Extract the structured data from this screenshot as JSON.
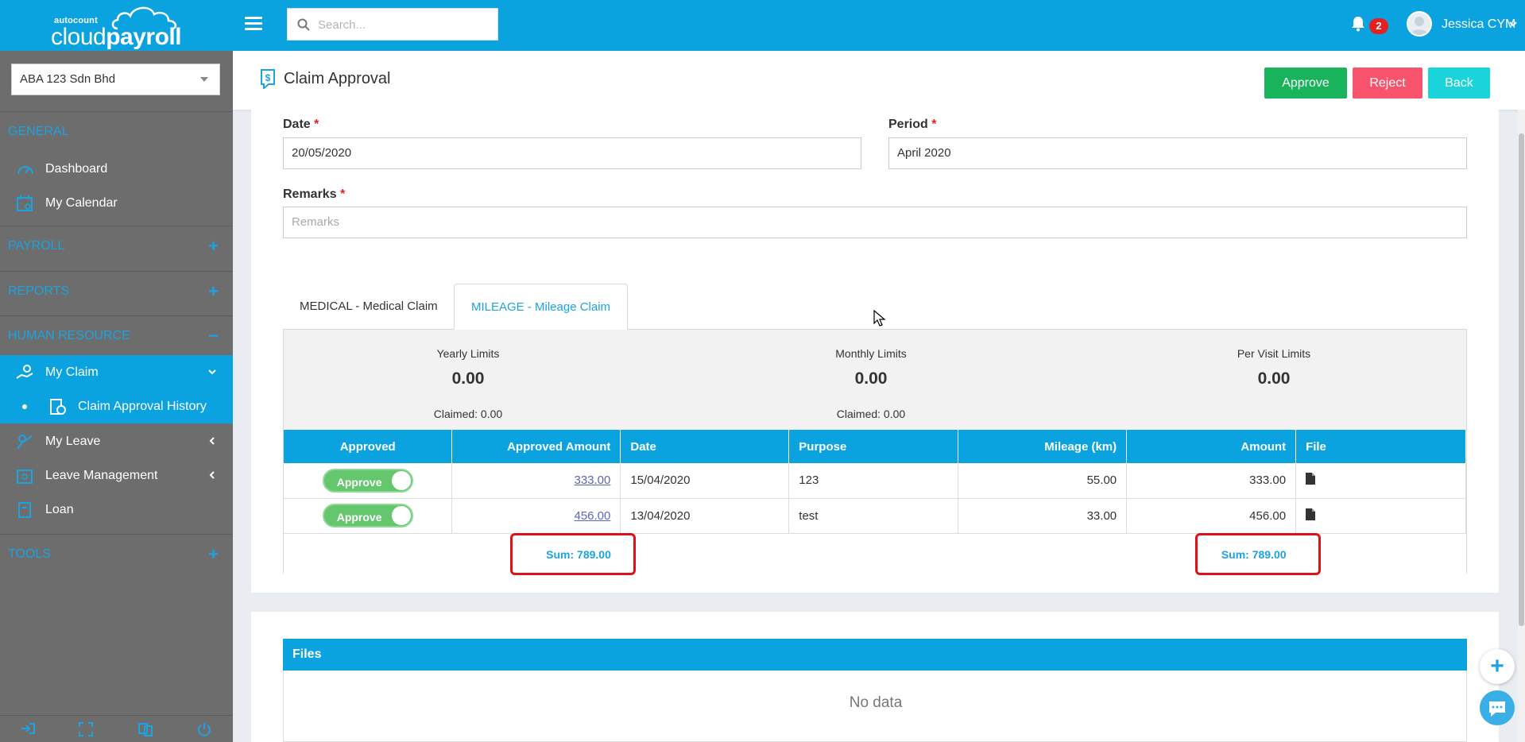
{
  "brand": {
    "small": "autocount",
    "cloud": "cloud",
    "payroll": "payroll"
  },
  "search": {
    "placeholder": "Search..."
  },
  "notifications": {
    "count": "2"
  },
  "user": {
    "name": "Jessica CYM"
  },
  "sidebar": {
    "company": "ABA 123 Sdn Bhd",
    "general": "GENERAL",
    "dashboard": "Dashboard",
    "calendar": "My Calendar",
    "payroll": "PAYROLL",
    "reports": "REPORTS",
    "hr": "HUMAN RESOURCE",
    "my_claim": "My Claim",
    "claim_history": "Claim Approval History",
    "my_leave": "My Leave",
    "leave_mgmt": "Leave Management",
    "loan": "Loan",
    "tools": "TOOLS"
  },
  "page": {
    "title": "Claim Approval",
    "approve": "Approve",
    "reject": "Reject",
    "back": "Back"
  },
  "form": {
    "date_label": "Date",
    "date_value": "20/05/2020",
    "period_label": "Period",
    "period_value": "April 2020",
    "remarks_label": "Remarks",
    "remarks_placeholder": "Remarks",
    "required": "*"
  },
  "tabs": {
    "medical": "MEDICAL - Medical Claim",
    "mileage": "MILEAGE - Mileage Claim"
  },
  "limits": {
    "yearly_label": "Yearly Limits",
    "yearly_value": "0.00",
    "yearly_claimed": "Claimed: 0.00",
    "monthly_label": "Monthly Limits",
    "monthly_value": "0.00",
    "monthly_claimed": "Claimed: 0.00",
    "pervisit_label": "Per Visit Limits",
    "pervisit_value": "0.00"
  },
  "table": {
    "headers": [
      "Approved",
      "Approved Amount",
      "Date",
      "Purpose",
      "Mileage (km)",
      "Amount",
      "File"
    ],
    "rows": [
      {
        "toggle": "Approve",
        "approved_amount": "333.00",
        "date": "15/04/2020",
        "purpose": "123",
        "mileage": "55.00",
        "amount": "333.00"
      },
      {
        "toggle": "Approve",
        "approved_amount": "456.00",
        "date": "13/04/2020",
        "purpose": "test",
        "mileage": "33.00",
        "amount": "456.00"
      }
    ],
    "sum_approved": "Sum: 789.00",
    "sum_amount": "Sum: 789.00"
  },
  "files": {
    "title": "Files",
    "empty": "No data"
  },
  "colors": {
    "primary": "#0aa2df",
    "approve": "#19b35c",
    "reject": "#f7536d",
    "back": "#1bd4d9",
    "sidebar": "#6d6d6d"
  }
}
